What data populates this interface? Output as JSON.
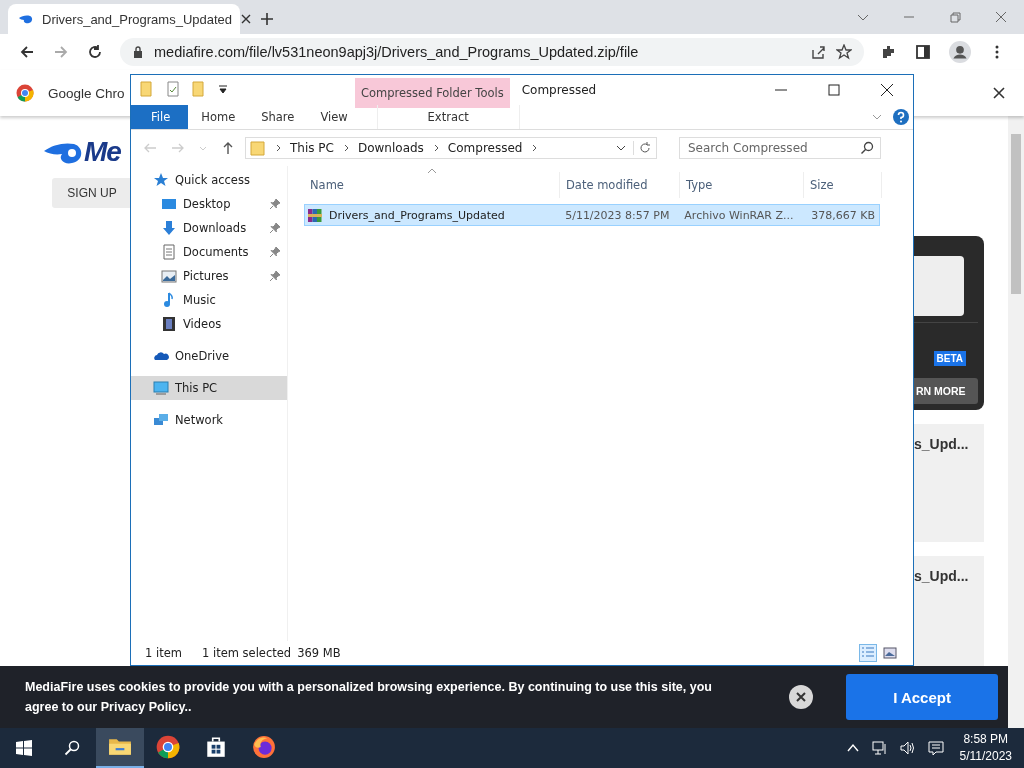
{
  "browser": {
    "tab_title": "Drivers_and_Programs_Updated",
    "url": "mediafire.com/file/lv531neon9apj3j/Drivers_and_Programs_Updated.zip/file",
    "infobar_text": "Google Chro"
  },
  "page": {
    "logo_text": "Me",
    "sign_up": "SIGN UP",
    "badge": "BETA",
    "learn_more": "RN MORE",
    "file_cards": [
      "s_Upd...",
      "s_Upd..."
    ]
  },
  "explorer": {
    "title": "Compressed",
    "context_tab": "Compressed Folder Tools",
    "ribbon_tabs": [
      {
        "label": "File",
        "kind": "file"
      },
      {
        "label": "Home",
        "kind": "tab"
      },
      {
        "label": "Share",
        "kind": "tab"
      },
      {
        "label": "View",
        "kind": "tab"
      },
      {
        "label": "Extract",
        "kind": "context"
      }
    ],
    "breadcrumb": [
      "This PC",
      "Downloads",
      "Compressed"
    ],
    "search": {
      "placeholder": "Search Compressed"
    },
    "nav": [
      {
        "label": "Quick access",
        "selected": false,
        "children": [
          {
            "label": "Desktop",
            "pinned": true,
            "selected": false
          },
          {
            "label": "Downloads",
            "pinned": true,
            "selected": false
          },
          {
            "label": "Documents",
            "pinned": true,
            "selected": false
          },
          {
            "label": "Pictures",
            "pinned": true,
            "selected": false
          },
          {
            "label": "Music",
            "pinned": false,
            "selected": false
          },
          {
            "label": "Videos",
            "pinned": false,
            "selected": false
          }
        ]
      },
      {
        "label": "OneDrive",
        "selected": false
      },
      {
        "label": "This PC",
        "selected": true
      },
      {
        "label": "Network",
        "selected": false
      }
    ],
    "columns": [
      "Name",
      "Date modified",
      "Type",
      "Size"
    ],
    "rows": [
      {
        "name": "Drivers_and_Programs_Updated",
        "date": "5/11/2023 8:57 PM",
        "type": "Archivo WinRAR Z...",
        "size": "378,667 KB",
        "selected": true
      }
    ],
    "status": {
      "count": "1 item",
      "selection": "1 item selected",
      "size": "369 MB"
    }
  },
  "cookie_banner": {
    "text": "MediaFire uses cookies to provide you with a personalized browsing experience. By continuing to use this site, you agree to our Privacy Policy..",
    "accept": "I Accept"
  },
  "taskbar": {
    "apps": [
      {
        "kind": "explorer",
        "active": true
      },
      {
        "kind": "chrome",
        "active": false
      },
      {
        "kind": "store",
        "active": false
      },
      {
        "kind": "firefox",
        "active": false
      }
    ],
    "time": "8:58 PM",
    "date": "5/11/2023"
  }
}
